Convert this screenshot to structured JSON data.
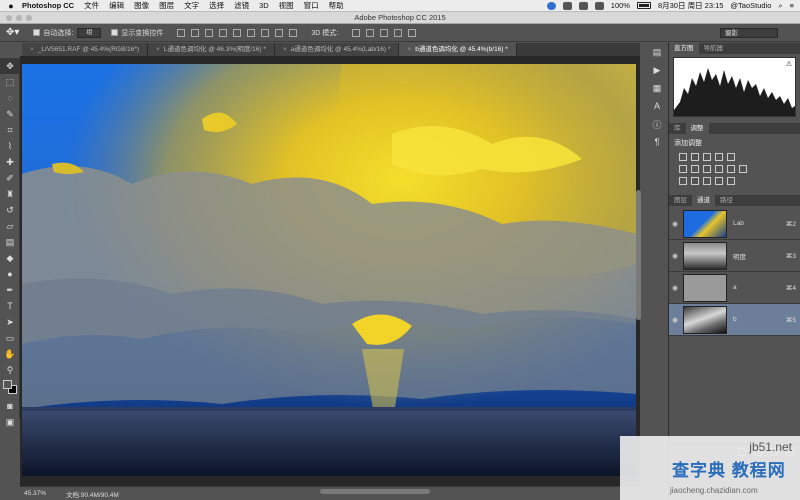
{
  "menubar": {
    "app_name": "Photoshop CC",
    "items": [
      "文件",
      "编辑",
      "图像",
      "图层",
      "文字",
      "选择",
      "滤镜",
      "3D",
      "视图",
      "窗口",
      "帮助"
    ],
    "battery": "100%",
    "datetime": "8月30日 周日 23:15",
    "user": "@TaoStudio"
  },
  "window": {
    "title": "Adobe Photoshop CC 2015"
  },
  "options": {
    "auto_select_label": "自动选择:",
    "auto_select_value": "组",
    "show_transform_label": "显示变换控件",
    "mode_3d_label": "3D 模式:",
    "workspace": "摄影"
  },
  "tabs": [
    {
      "label": "_LIV5651.RAF @ 45.4%(RGB/16*)",
      "active": false
    },
    {
      "label": "L通道色调均化 @ 46.3%(明度/16) *",
      "active": false
    },
    {
      "label": "a通道色调均化 @ 45.4%(Lab/16) *",
      "active": false
    },
    {
      "label": "b通道色调均化 @ 45.4%(b/16) *",
      "active": true
    }
  ],
  "status": {
    "zoom": "45.37%",
    "doc_size": "文档:90.4M/90.4M"
  },
  "panels": {
    "top_tabs": [
      "直方图",
      "导航器"
    ],
    "adjust_tabs": [
      "库",
      "调整"
    ],
    "adjust_title": "添加调整",
    "bottom_tabs": [
      "图层",
      "通道",
      "路径"
    ]
  },
  "channels": [
    {
      "name": "Lab",
      "shortcut": "⌘2",
      "selected": false
    },
    {
      "name": "明度",
      "shortcut": "⌘3",
      "selected": false
    },
    {
      "name": "a",
      "shortcut": "⌘4",
      "selected": false
    },
    {
      "name": "b",
      "shortcut": "⌘5",
      "selected": true
    }
  ],
  "watermark": {
    "site": "jb51.net",
    "main": "查字典 教程网",
    "url": "jiaocheng.chazidian.com"
  }
}
